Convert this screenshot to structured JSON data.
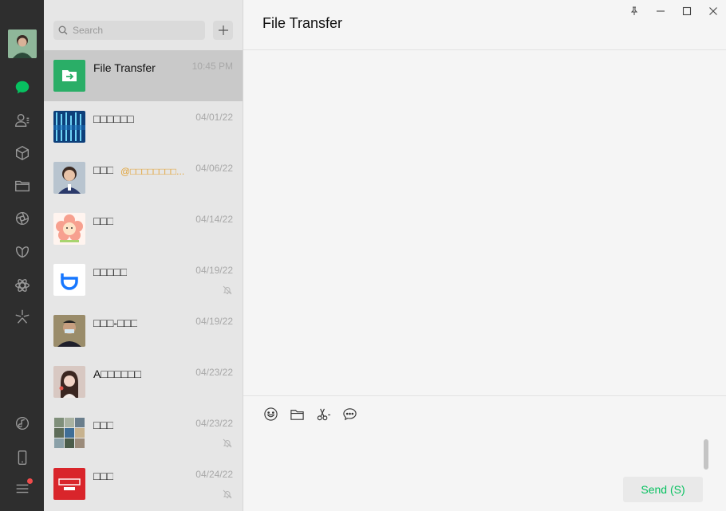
{
  "colors": {
    "accent": "#07c160",
    "rail": "#2e2e2e",
    "list_bg": "#e6e6e6",
    "active_row": "#c9c9c9",
    "mention": "#e2a43a",
    "badge": "#f04b4b"
  },
  "rail": {
    "avatar_icon": "user-avatar",
    "items": [
      {
        "icon": "chat-bubble-icon"
      },
      {
        "icon": "contacts-icon"
      },
      {
        "icon": "box-icon"
      },
      {
        "icon": "folder-icon"
      },
      {
        "icon": "aperture-icon"
      },
      {
        "icon": "butterfly-icon"
      },
      {
        "icon": "atom-icon"
      },
      {
        "icon": "sparkle-icon"
      }
    ],
    "bottom": [
      {
        "icon": "music-icon"
      },
      {
        "icon": "phone-icon"
      },
      {
        "icon": "menu-icon",
        "badge": true
      }
    ]
  },
  "search": {
    "placeholder": "Search"
  },
  "chats": [
    {
      "name": "File Transfer",
      "time": "10:45 PM",
      "active": true,
      "avatar": "file-transfer"
    },
    {
      "name": "□□□□□□",
      "time": "04/01/22",
      "avatar": "blue-pattern"
    },
    {
      "name": "□□□",
      "mention": "@□□□□□□□□...",
      "time": "04/06/22",
      "avatar": "person-portrait"
    },
    {
      "name": "□□□",
      "time": "04/14/22",
      "avatar": "cartoon-flower"
    },
    {
      "name": "□□□□□",
      "time": "04/19/22",
      "muted": true,
      "avatar": "didi-logo"
    },
    {
      "name": "□□□-□□□",
      "time": "04/19/22",
      "avatar": "masked-man"
    },
    {
      "name": "A□□□□□□",
      "time": "04/23/22",
      "avatar": "woman-portrait"
    },
    {
      "name": "□□□",
      "time": "04/23/22",
      "muted": true,
      "avatar": "photo-grid"
    },
    {
      "name": "□□□",
      "time": "04/24/22",
      "muted": true,
      "avatar": "red-logo"
    }
  ],
  "header": {
    "title": "File Transfer"
  },
  "composer": {
    "tools": [
      "emoji-icon",
      "folder-icon",
      "screenshot-scissors-icon",
      "chat-history-icon"
    ],
    "send_label": "Send (S)"
  },
  "window_buttons": [
    "pin-icon",
    "minimize-icon",
    "maximize-icon",
    "close-icon"
  ]
}
